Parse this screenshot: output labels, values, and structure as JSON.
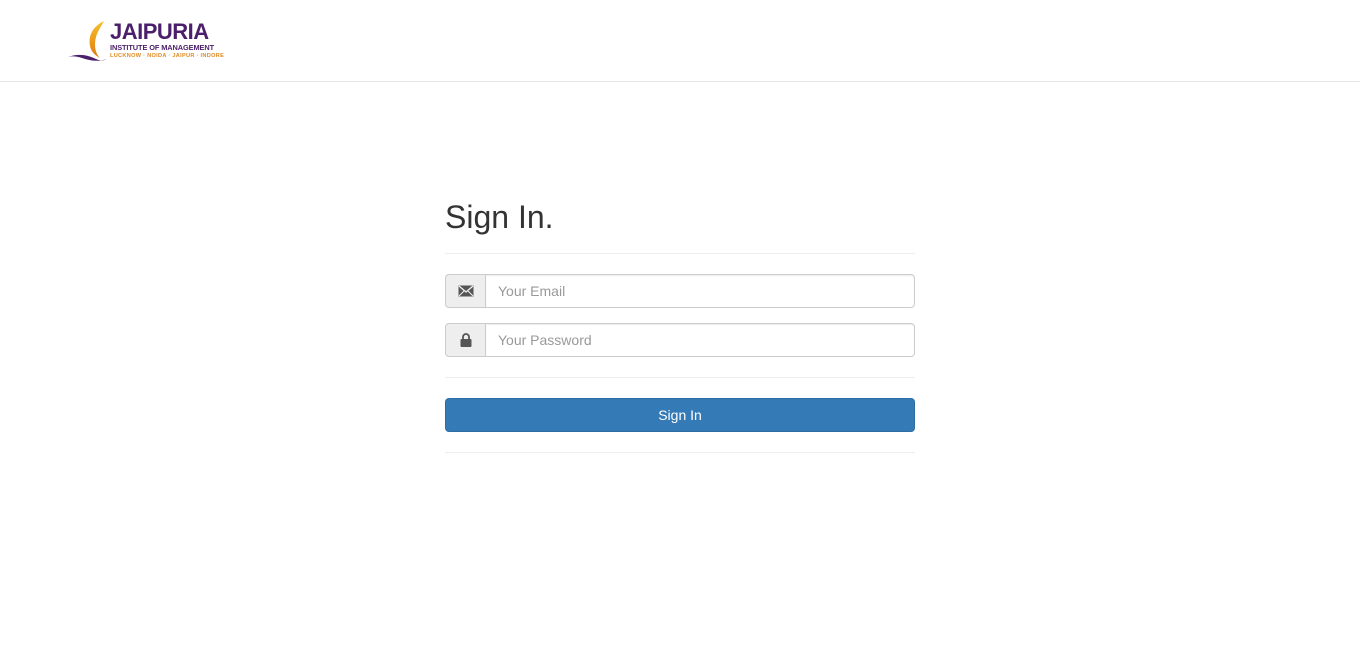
{
  "brand": {
    "name": "JAIPURIA",
    "subtitle": "INSTITUTE OF MANAGEMENT",
    "cities": "LUCKNOW · NOIDA · JAIPUR · INDORE",
    "colors": {
      "purple": "#4b1f6b",
      "orange": "#e08a1e"
    }
  },
  "form": {
    "title": "Sign In.",
    "email": {
      "value": "",
      "placeholder": "Your Email",
      "icon": "envelope-icon"
    },
    "password": {
      "value": "",
      "placeholder": "Your Password",
      "icon": "lock-icon"
    },
    "submit_label": "Sign In"
  },
  "colors": {
    "primary": "#337ab7"
  }
}
